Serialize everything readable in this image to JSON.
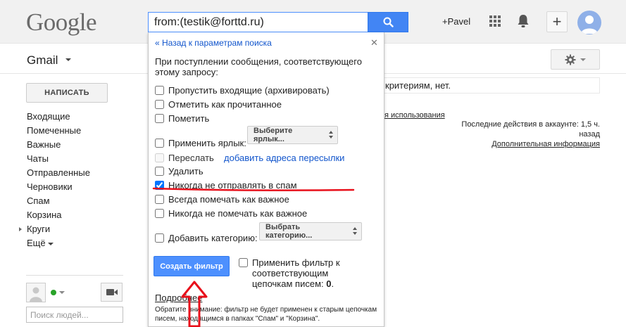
{
  "header": {
    "logo": "Google",
    "search_value": "from:(testik@forttd.ru)",
    "user": "+Pavel",
    "plus": "+"
  },
  "subbar": {
    "gmail_label": "Gmail"
  },
  "sidebar": {
    "compose_label": "НАПИСАТЬ",
    "items": [
      {
        "label": "Входящие"
      },
      {
        "label": "Помеченные"
      },
      {
        "label": "Важные"
      },
      {
        "label": "Чаты"
      },
      {
        "label": "Отправленные"
      },
      {
        "label": "Черновики"
      },
      {
        "label": "Спам"
      },
      {
        "label": "Корзина"
      },
      {
        "label": "Круги"
      },
      {
        "label": "Ещё"
      }
    ],
    "people_search_placeholder": "Поиск людей..."
  },
  "main": {
    "info_text": "критериям, нет.",
    "terms_link": "я использования",
    "activity_line1": "Последние действия в аккаунте: 1,5 ч.",
    "activity_line2": "назад",
    "activity_link": "Дополнительная информация"
  },
  "filter_popup": {
    "back_link": "« Назад к параметрам поиска",
    "heading": "При поступлении сообщения, соответствующего этому запросу:",
    "options": {
      "skip_inbox": {
        "label": "Пропустить входящие (архивировать)",
        "checked": false
      },
      "mark_read": {
        "label": "Отметить как прочитанное",
        "checked": false
      },
      "star": {
        "label": "Пометить",
        "checked": false
      },
      "apply_label": {
        "label": "Применить ярлык:",
        "checked": false
      },
      "forward": {
        "label": "Переслать",
        "checked": false
      },
      "delete": {
        "label": "Удалить",
        "checked": false
      },
      "never_spam": {
        "label": "Никогда не отправлять в спам",
        "checked": true
      },
      "always_important": {
        "label": "Всегда помечать как важное",
        "checked": false
      },
      "never_important": {
        "label": "Никогда не помечать как важное",
        "checked": false
      },
      "category": {
        "label": "Добавить категорию:",
        "checked": false
      }
    },
    "label_select": "Выберите ярлык...",
    "forward_link": "добавить адреса пересылки",
    "category_select": "Выбрать категорию...",
    "create_button": "Создать фильтр",
    "apply_to_existing_prefix": "Применить фильтр к соответствующим цепочкам писем: ",
    "apply_to_existing_count": "0",
    "apply_to_existing_suffix": ".",
    "more_link": "Подробнее",
    "note": "Обратите внимание: фильтр не будет применен к старым цепочкам писем, находящимся в папках \"Спам\" и \"Корзина\"."
  },
  "colors": {
    "accent_blue": "#4d90fe",
    "link_blue": "#1155cc",
    "annotation_red": "#e8101b",
    "online_green": "#29a329"
  }
}
